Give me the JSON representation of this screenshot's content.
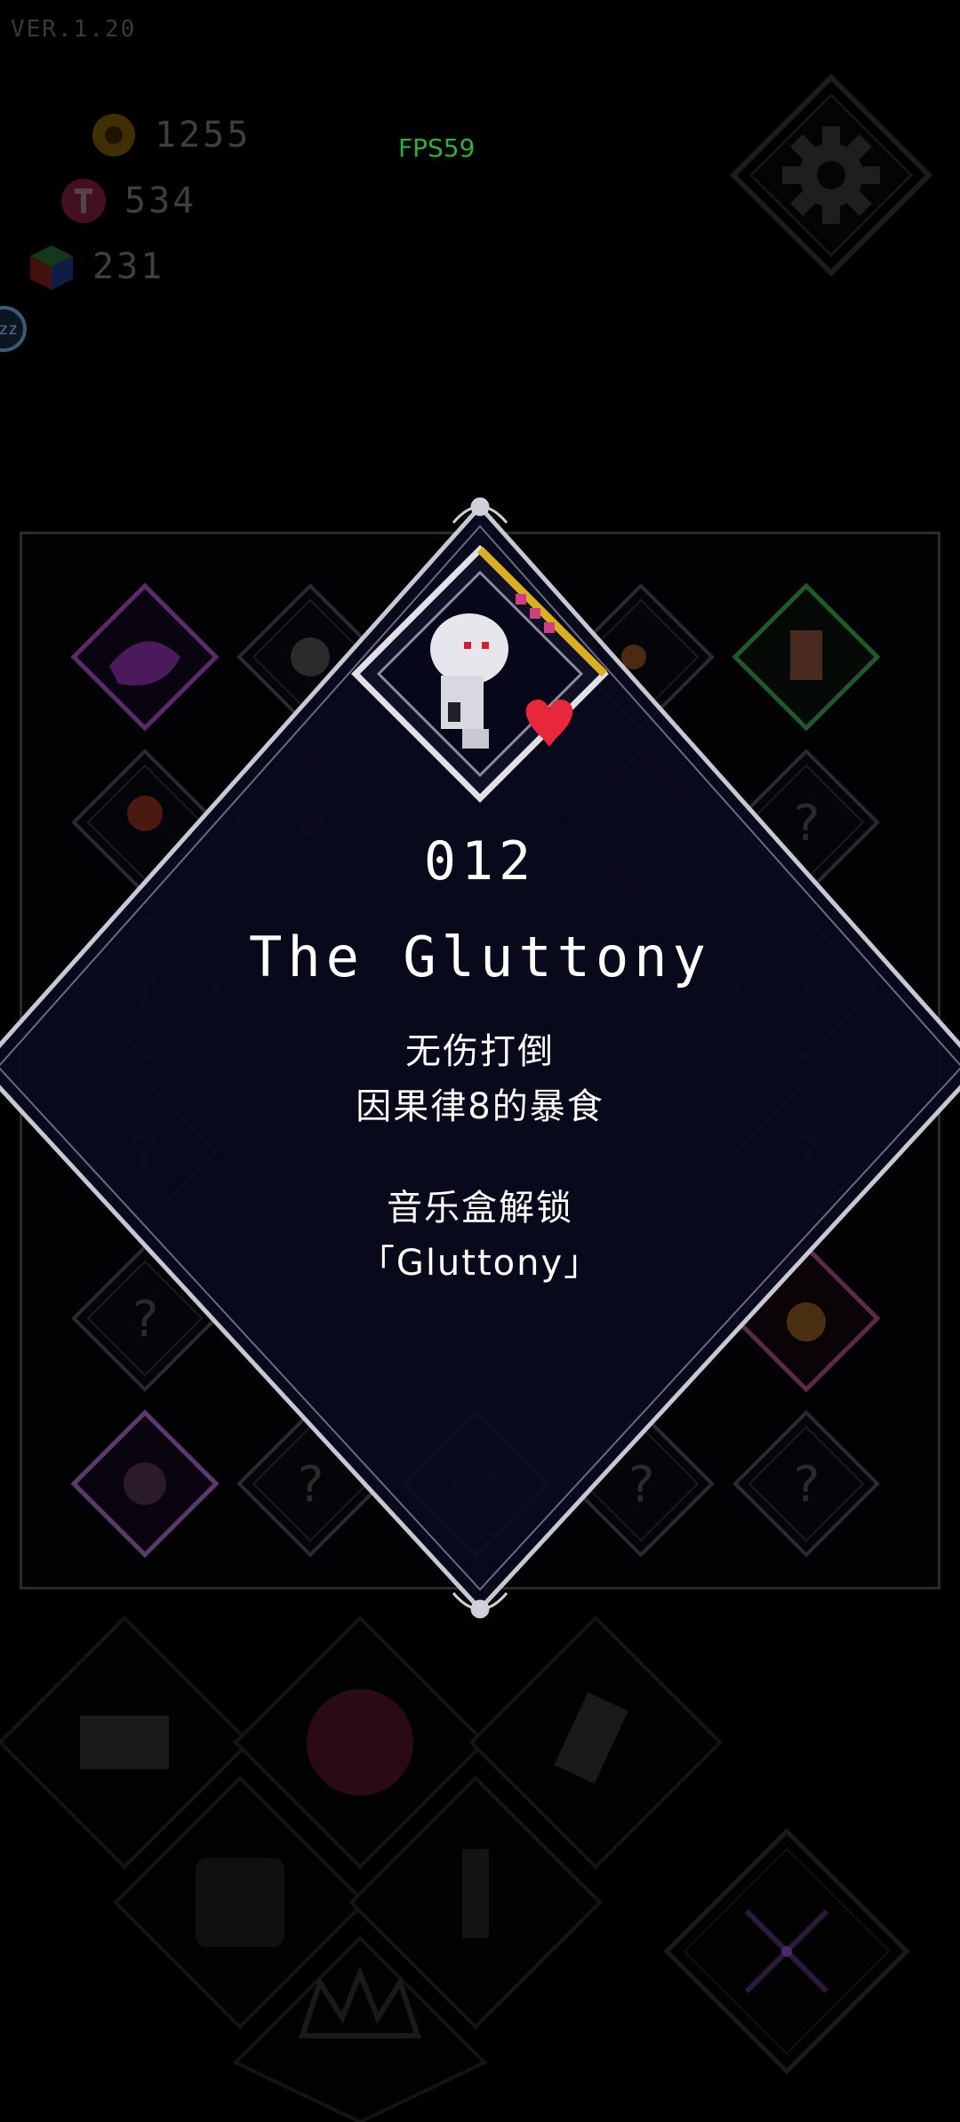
{
  "version": "VER.1.20",
  "fps": "FPS59",
  "currencies": [
    {
      "icon": "gear-coin-icon",
      "value": "1255"
    },
    {
      "icon": "pink-token-icon",
      "value": "534"
    },
    {
      "icon": "cube-icon",
      "value": "231"
    }
  ],
  "sleep_badge": "zz",
  "grid": {
    "unknown_mark": "?"
  },
  "achievement": {
    "number": "012",
    "title": "The Gluttony",
    "condition_line1": "无伤打倒",
    "condition_line2": "因果律8的暴食",
    "reward_line1": "音乐盒解锁",
    "reward_line2": "「Gluttony」"
  },
  "colors": {
    "background": "#000000",
    "modal_fill": "#0a0a1e",
    "modal_border": "#d8d8e0",
    "fps_green": "#2fae3c",
    "heart_red": "#e8283a",
    "gold": "#d8b020"
  }
}
